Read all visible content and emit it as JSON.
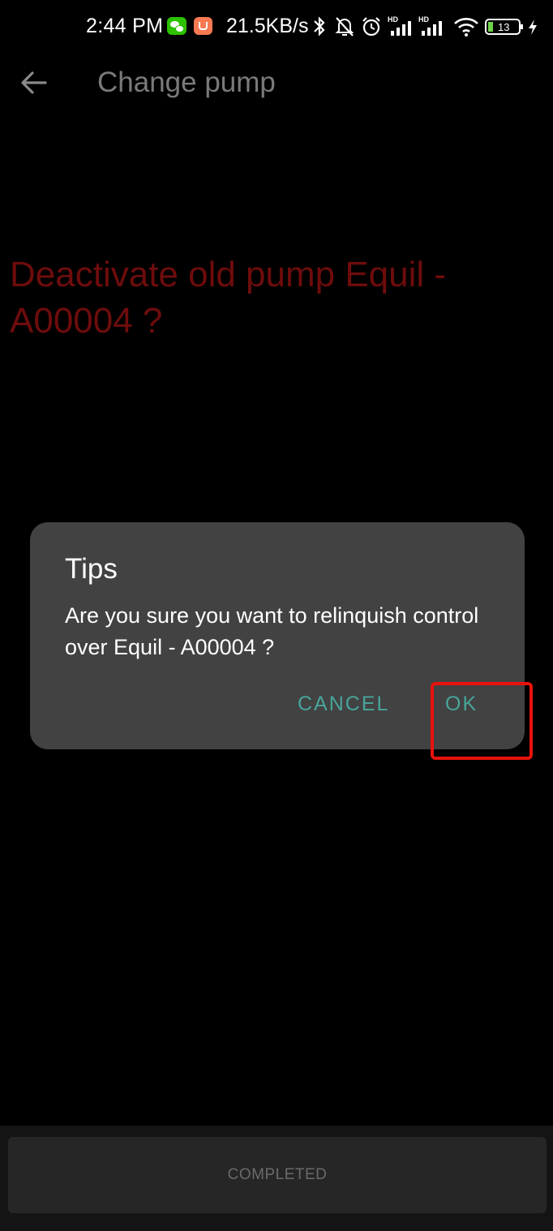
{
  "status_bar": {
    "time": "2:44 PM",
    "net_speed": "21.5KB/s",
    "battery": "13",
    "icons": [
      "wechat-icon",
      "notification-app-icon",
      "bluetooth-icon",
      "mute-bell-icon",
      "alarm-icon",
      "hd-signal-icon",
      "hd-signal-icon",
      "wifi-icon",
      "battery-icon",
      "charging-icon"
    ]
  },
  "header": {
    "title": "Change pump"
  },
  "main": {
    "question": "Deactivate old pump Equil - A00004 ?"
  },
  "dialog": {
    "title": "Tips",
    "message": "Are you sure you want to relinquish control over Equil - A00004 ?",
    "cancel_label": "CANCEL",
    "ok_label": "OK"
  },
  "footer": {
    "completed_label": "COMPLETED"
  },
  "colors": {
    "accent": "#47a59a",
    "question_text": "#6e0c0c",
    "highlight": "#e8120c",
    "dialog_bg": "#424242"
  }
}
